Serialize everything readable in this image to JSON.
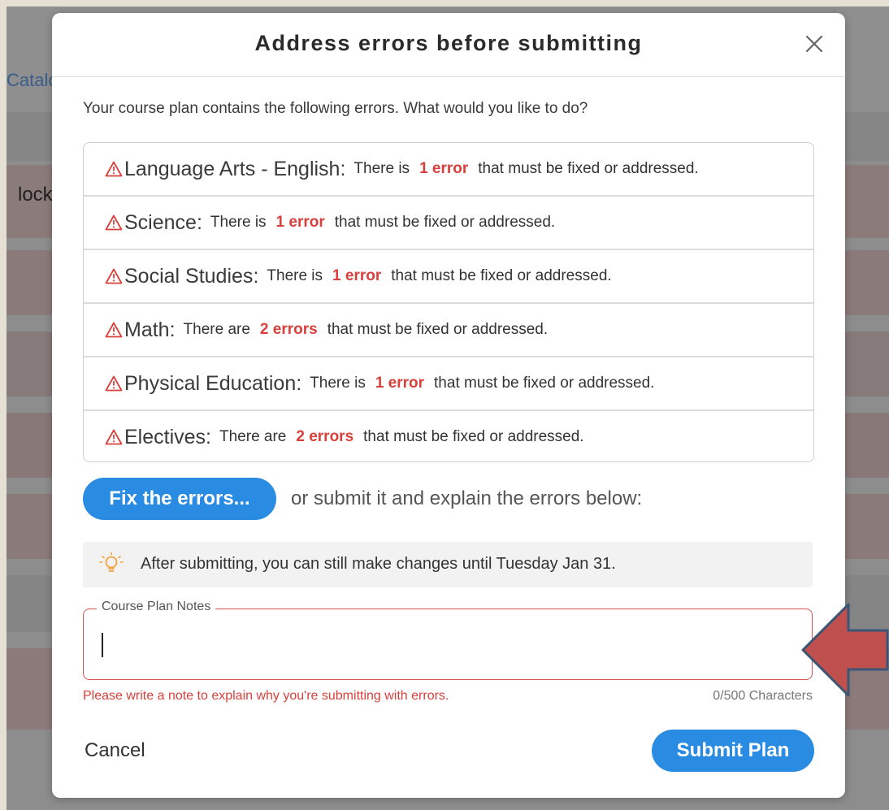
{
  "background": {
    "link_fragment": "Catalo",
    "text_fragment": "lock"
  },
  "modal": {
    "title": "Address errors before submitting",
    "intro": "Your course plan contains the following errors. What would you like to do?",
    "errors": [
      {
        "subject": "Language Arts - English",
        "sep": " :",
        "prefix": "There is",
        "count": "1 error",
        "suffix": "that must be fixed or addressed."
      },
      {
        "subject": "Science",
        "sep": ":",
        "prefix": "There is",
        "count": "1 error",
        "suffix": "that must be fixed or addressed."
      },
      {
        "subject": "Social Studies",
        "sep": ":",
        "prefix": "There is",
        "count": "1 error",
        "suffix": "that must be fixed or addressed."
      },
      {
        "subject": "Math",
        "sep": ":",
        "prefix": "There are",
        "count": "2 errors",
        "suffix": "that must be fixed or addressed."
      },
      {
        "subject": "Physical Education",
        "sep": ":",
        "prefix": "There is",
        "count": "1 error",
        "suffix": "that must be fixed or addressed."
      },
      {
        "subject": "Electives",
        "sep": ":",
        "prefix": "There are",
        "count": "2 errors",
        "suffix": "that must be fixed or addressed."
      }
    ],
    "fix_button": "Fix the errors...",
    "or_text": "or submit it and explain the errors below:",
    "info": "After submitting, you can still make changes until Tuesday Jan 31.",
    "notes": {
      "label": "Course Plan Notes",
      "value": "",
      "error": "Please write a note to explain why you're submitting with errors.",
      "char_count": "0/500 Characters"
    },
    "cancel_button": "Cancel",
    "submit_button": "Submit Plan"
  },
  "colors": {
    "accent": "#2a8be3",
    "error": "#d9403b",
    "arrow": "#c0504d"
  },
  "icons": [
    "close-icon",
    "warning-triangle-icon",
    "lightbulb-icon",
    "arrow-left-annotation"
  ]
}
